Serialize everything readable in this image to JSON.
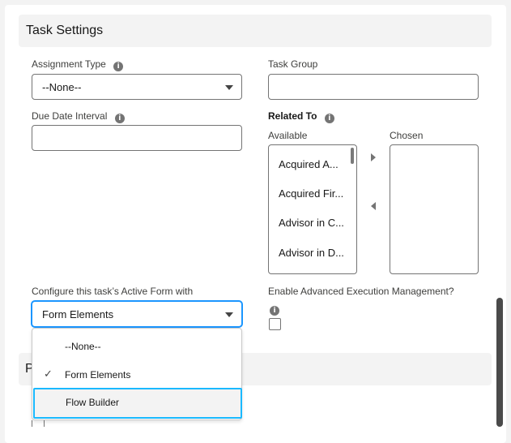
{
  "task_settings": {
    "title": "Task Settings"
  },
  "assignment_type": {
    "label": "Assignment Type",
    "value": "--None--"
  },
  "task_group": {
    "label": "Task Group",
    "value": ""
  },
  "due_date_interval": {
    "label": "Due Date Interval",
    "value": ""
  },
  "related_to": {
    "label": "Related To",
    "available_label": "Available",
    "chosen_label": "Chosen",
    "available": [
      "Acquired A...",
      "Acquired Fir...",
      "Advisor in C...",
      "Advisor in D..."
    ],
    "chosen": []
  },
  "active_form": {
    "label": "Configure this task’s Active Form with",
    "value": "Form Elements",
    "options": [
      {
        "label": "--None--",
        "checked": false
      },
      {
        "label": "Form Elements",
        "checked": true
      },
      {
        "label": "Flow Builder",
        "checked": false,
        "focused": true
      }
    ]
  },
  "advanced_exec": {
    "label": "Enable Advanced Execution Management?",
    "checked": false
  },
  "next_section": {
    "title_partial": "P"
  },
  "icons": {
    "info": "info-icon",
    "check": "checkmark-icon"
  },
  "colors": {
    "focus_ring": "#1ab9ff",
    "header_bg": "#f3f3f3",
    "border": "#747474"
  }
}
